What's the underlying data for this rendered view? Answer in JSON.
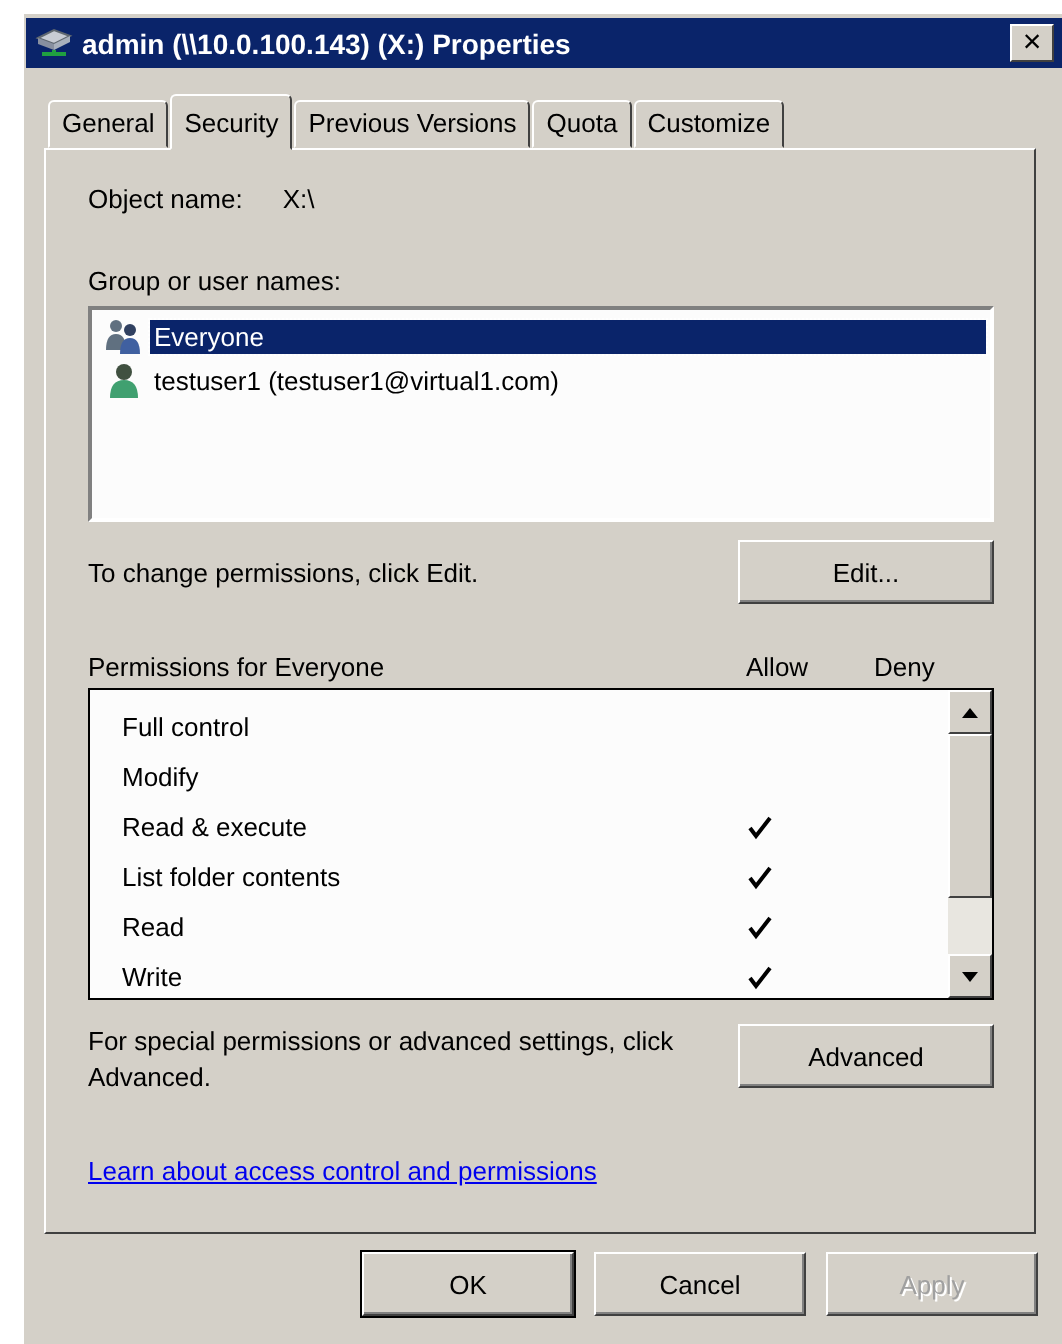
{
  "window": {
    "title": "admin (\\\\10.0.100.143) (X:) Properties",
    "close": "×"
  },
  "tabs": [
    {
      "label": "General",
      "selected": false
    },
    {
      "label": "Security",
      "selected": true
    },
    {
      "label": "Previous Versions",
      "selected": false
    },
    {
      "label": "Quota",
      "selected": false
    },
    {
      "label": "Customize",
      "selected": false
    }
  ],
  "object_name": {
    "label": "Object name:",
    "value": "X:\\"
  },
  "group_list": {
    "label": "Group or user names:",
    "items": [
      {
        "name": "Everyone",
        "kind": "group",
        "selected": true
      },
      {
        "name": "testuser1 (testuser1@virtual1.com)",
        "kind": "user",
        "selected": false
      }
    ]
  },
  "edit_hint": "To change permissions, click Edit.",
  "edit_button": "Edit...",
  "permissions": {
    "label": "Permissions for Everyone",
    "allow_header": "Allow",
    "deny_header": "Deny",
    "rows": [
      {
        "name": "Full control",
        "allow": false,
        "deny": false
      },
      {
        "name": "Modify",
        "allow": false,
        "deny": false
      },
      {
        "name": "Read & execute",
        "allow": true,
        "deny": false
      },
      {
        "name": "List folder contents",
        "allow": true,
        "deny": false
      },
      {
        "name": "Read",
        "allow": true,
        "deny": false
      },
      {
        "name": "Write",
        "allow": true,
        "deny": false
      }
    ]
  },
  "advanced_hint": "For special permissions or advanced settings, click Advanced.",
  "advanced_button": "Advanced",
  "link": "Learn about access control and permissions",
  "buttons": [
    {
      "label": "OK",
      "kind": "default",
      "disabled": false
    },
    {
      "label": "Cancel",
      "kind": "normal",
      "disabled": false
    },
    {
      "label": "Apply",
      "kind": "normal",
      "disabled": true
    }
  ]
}
